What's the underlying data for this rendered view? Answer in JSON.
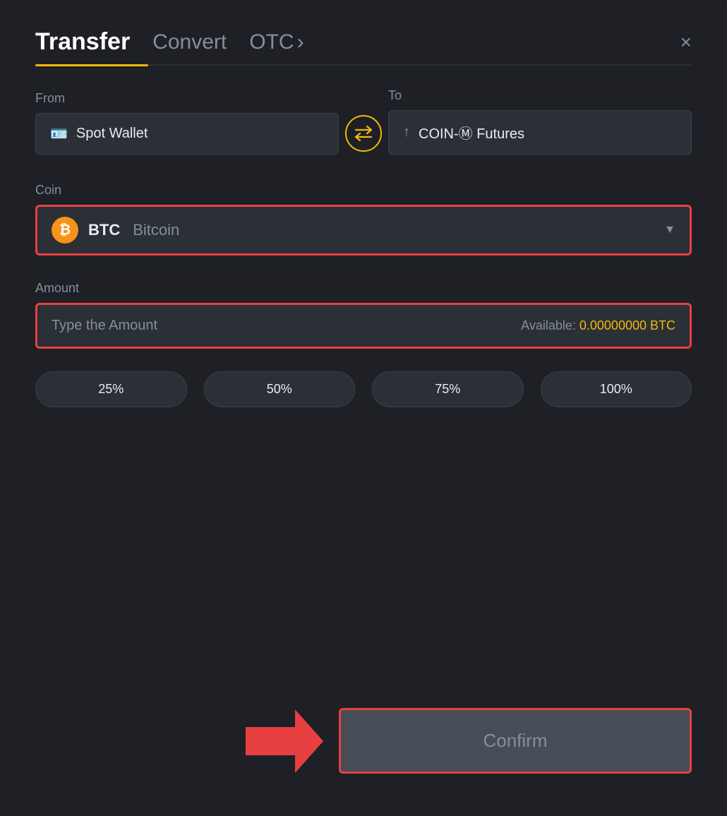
{
  "header": {
    "tab_transfer": "Transfer",
    "tab_convert": "Convert",
    "tab_otc": "OTC",
    "close_label": "×"
  },
  "from": {
    "label": "From",
    "wallet_name": "Spot Wallet"
  },
  "to": {
    "label": "To",
    "wallet_name": "COIN-Ⓜ Futures"
  },
  "coin": {
    "label": "Coin",
    "symbol": "BTC",
    "name": "Bitcoin"
  },
  "amount": {
    "label": "Amount",
    "placeholder": "Type the Amount",
    "available_label": "Available:",
    "available_value": "0.00000000 BTC"
  },
  "percentages": [
    "25%",
    "50%",
    "75%",
    "100%"
  ],
  "confirm_button": "Confirm"
}
